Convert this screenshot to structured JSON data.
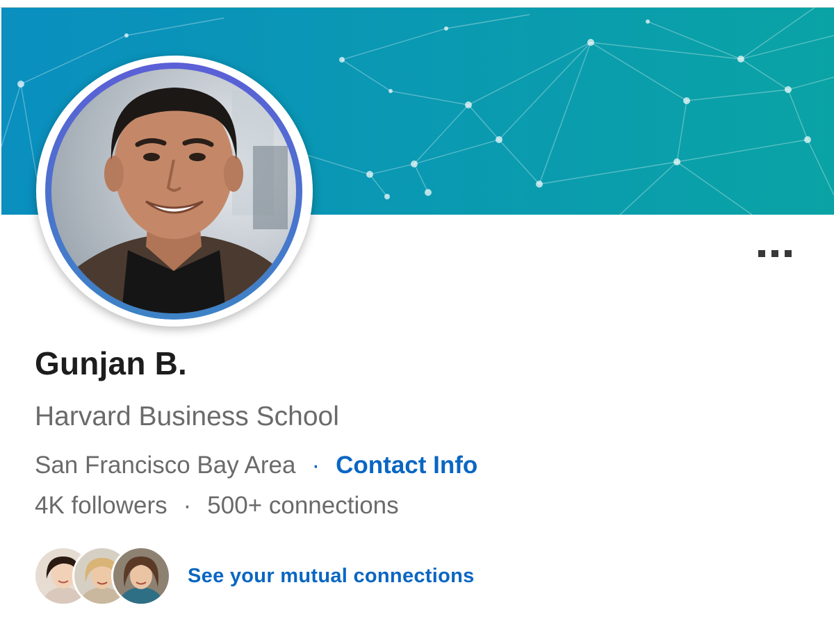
{
  "profile": {
    "name": "Gunjan B.",
    "headline": "Harvard Business School",
    "location": "San Francisco Bay Area",
    "separator": "·",
    "contact_label": "Contact Info",
    "followers": "4K followers",
    "connections": "500+ connections",
    "mutual_label": "See your mutual connections"
  },
  "icons": {
    "more": "more-options-icon"
  },
  "colors": {
    "banner_start": "#0a8fbf",
    "banner_end": "#0aa3a5",
    "link_blue": "#0a66c2",
    "avatar_ring_start": "#5b5fd6",
    "avatar_ring_end": "#3d83c6",
    "name_text": "#1d1d1d",
    "secondary_text": "#6a6a6a"
  }
}
